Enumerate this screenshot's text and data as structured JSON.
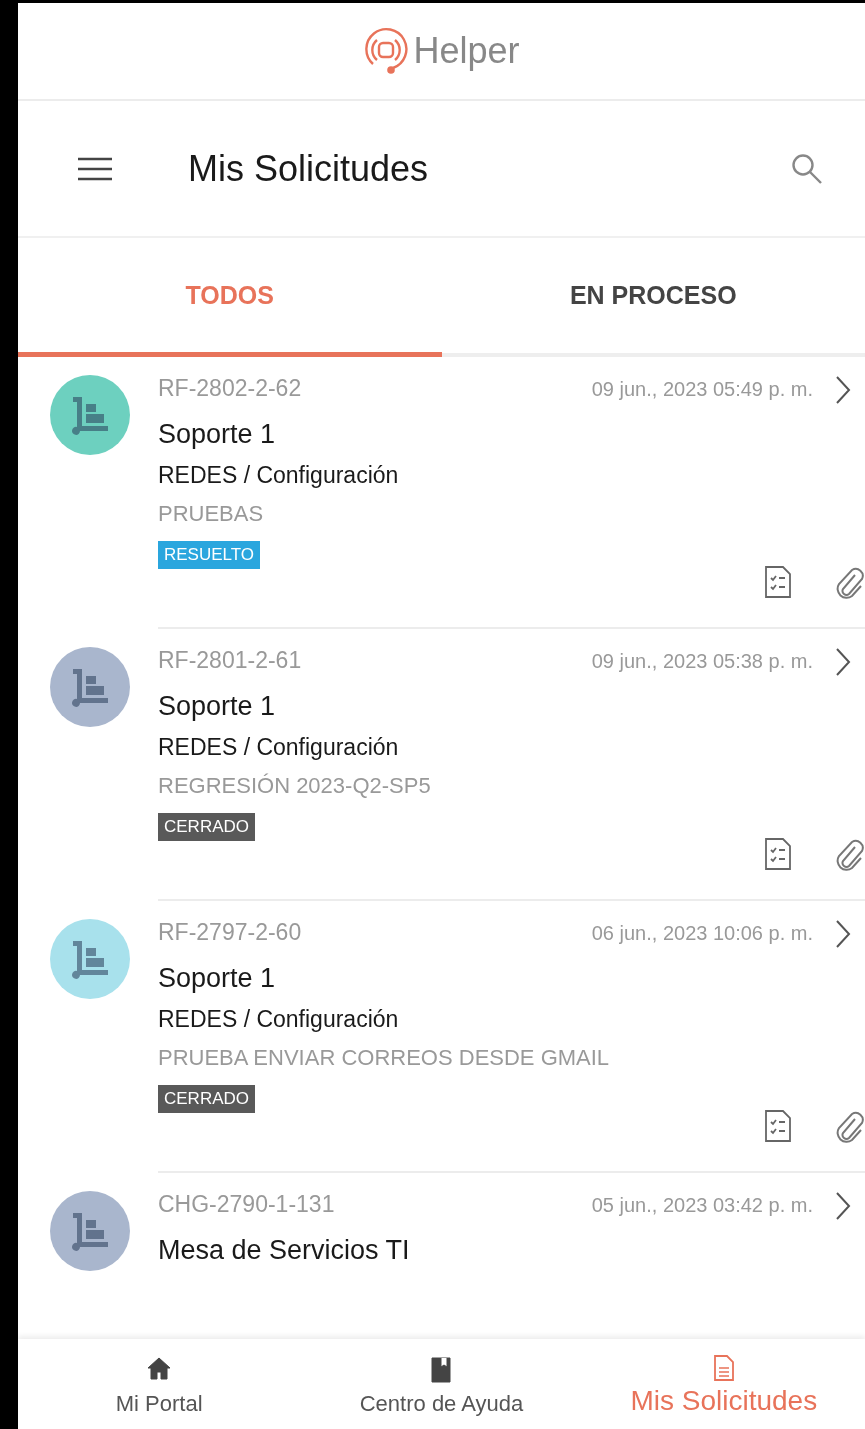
{
  "header": {
    "app_name": "Helper"
  },
  "toolbar": {
    "title": "Mis Solicitudes"
  },
  "tabs": [
    {
      "label": "TODOS",
      "selected": true
    },
    {
      "label": "EN PROCESO",
      "selected": false
    }
  ],
  "requests": [
    {
      "avatar": {
        "color": "#6dd0bf"
      },
      "id": "RF-2802-2-62",
      "date": "09 jun., 2023 05:49 p. m.",
      "title": "Soporte 1",
      "category": "REDES / Configuración",
      "description": "PRUEBAS",
      "status": {
        "label": "RESUELTO",
        "color": "#2aa6de"
      }
    },
    {
      "avatar": {
        "color": "#a9b6cd"
      },
      "id": "RF-2801-2-61",
      "date": "09 jun., 2023 05:38 p. m.",
      "title": "Soporte 1",
      "category": "REDES / Configuración",
      "description": "REGRESIÓN 2023-Q2-SP5",
      "status": {
        "label": "CERRADO",
        "color": "#595959"
      }
    },
    {
      "avatar": {
        "color": "#a8e1ec"
      },
      "id": "RF-2797-2-60",
      "date": "06 jun., 2023 10:06 p. m.",
      "title": "Soporte 1",
      "category": "REDES / Configuración",
      "description": "PRUEBA ENVIAR CORREOS DESDE GMAIL",
      "status": {
        "label": "CERRADO",
        "color": "#595959"
      }
    },
    {
      "avatar": {
        "color": "#a9b6cd"
      },
      "id": "CHG-2790-1-131",
      "date": "05 jun., 2023 03:42 p. m.",
      "title": "Mesa de Servicios TI"
    }
  ],
  "bottom_nav": [
    {
      "kind": "home",
      "label": "Mi Portal",
      "selected": false
    },
    {
      "kind": "book",
      "label": "Centro de Ayuda",
      "selected": false
    },
    {
      "kind": "document",
      "label": "Mis Solicitudes",
      "selected": true
    }
  ]
}
